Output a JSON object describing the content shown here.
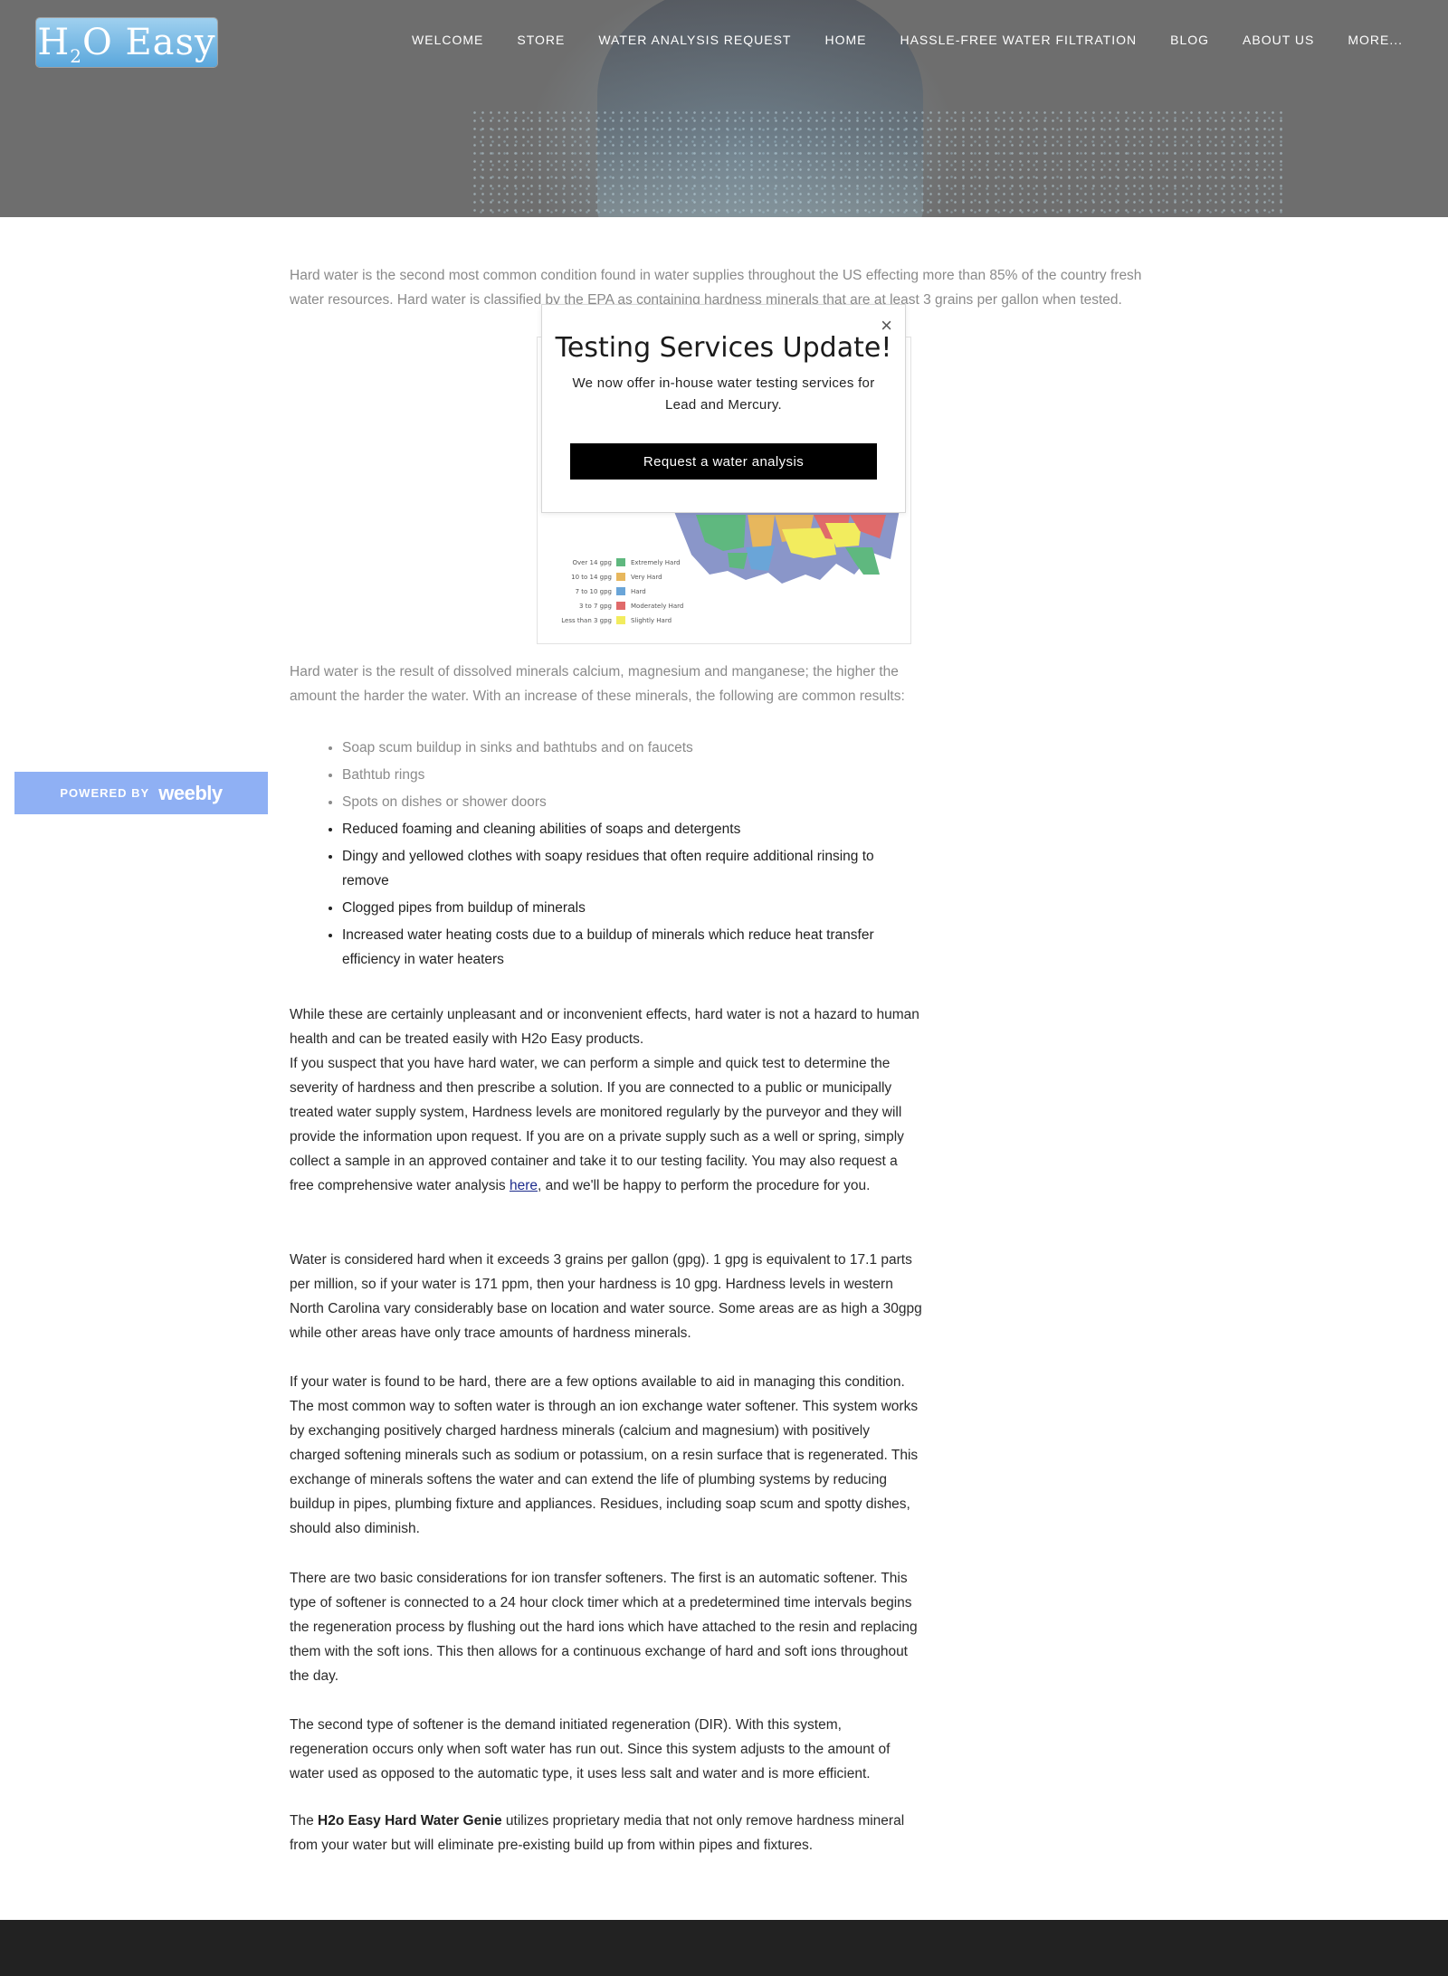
{
  "brand": {
    "logo_text": "H2O Easy"
  },
  "nav": {
    "items": [
      {
        "label": "WELCOME"
      },
      {
        "label": "STORE"
      },
      {
        "label": "WATER ANALYSIS REQUEST"
      },
      {
        "label": "HOME"
      },
      {
        "label": "HASSLE-FREE WATER FILTRATION"
      },
      {
        "label": "BLOG"
      },
      {
        "label": "ABOUT US"
      },
      {
        "label": "MORE..."
      }
    ]
  },
  "content": {
    "intro": "Hard water is the second most common condition found in water supplies throughout the US effecting more than 85% of the country fresh water resources. Hard water is classified by the EPA as containing hardness minerals that are at least 3 grains per gallon when tested.",
    "map_legend": [
      {
        "label": "Over 14 gpg",
        "name": "Extremely Hard",
        "color": "#5fb87f"
      },
      {
        "label": "10 to 14 gpg",
        "name": "Very Hard",
        "color": "#e7b75d"
      },
      {
        "label": "7 to 10 gpg",
        "name": "Hard",
        "color": "#6aa5d8"
      },
      {
        "label": "3 to 7 gpg",
        "name": "Moderately Hard",
        "color": "#e06a6a"
      },
      {
        "label": "Less than 3 gpg",
        "name": "Slightly Hard",
        "color": "#f2ec5e"
      }
    ],
    "p1": "Hard water is the result of dissolved minerals calcium, magnesium and manganese; the higher the amount the harder the water. With an increase of these minerals, the following are common results:",
    "list": [
      "Soap scum buildup in sinks and bathtubs and on faucets",
      "Bathtub rings",
      "Spots on dishes or shower doors",
      "Reduced foaming and cleaning abilities of soaps and detergents",
      "Dingy and yellowed clothes with soapy residues that often require additional rinsing to remove",
      "Clogged pipes from buildup of minerals",
      "Increased water heating costs due to a buildup of minerals which reduce heat transfer efficiency in water heaters"
    ],
    "p2": "While these are certainly unpleasant and or inconvenient effects, hard water is not a hazard to human health and can be treated easily with H2o Easy products.",
    "p3_before": "If you suspect that you have hard water, we can perform a simple and quick test to determine the severity of hardness and then prescribe a solution. If you are connected to a public or municipally treated water supply system, Hardness levels are monitored regularly by the purveyor and they will provide the information upon request. If you are on a private supply such as a well or spring, simply collect a sample in an approved container and take it to our testing facility. You may also request a free comprehensive water analysis ",
    "p3_link": "here",
    "p3_after": ", and we'll be happy to perform the procedure for you.",
    "p4": "Water is considered hard when it exceeds 3 grains per gallon (gpg). 1 gpg is equivalent to 17.1 parts per million, so if your water is 171 ppm, then your hardness is 10 gpg. Hardness levels in western North Carolina vary considerably base on location and water source. Some areas are as high a 30gpg while other areas have only trace amounts of hardness minerals.",
    "p5": "If your water is found to be hard, there are a few options available to aid in managing this condition. The most common way to soften water is through an ion exchange water softener. This system works by exchanging positively charged hardness minerals (calcium and magnesium) with positively charged softening minerals such as sodium or potassium, on a resin surface that is regenerated. This exchange of minerals softens the water and can extend the life of plumbing systems by reducing buildup in pipes, plumbing fixture and appliances. Residues, including soap scum and spotty dishes, should also diminish.",
    "p6": "There are two basic considerations for ion transfer softeners. The first is an automatic softener. This type of softener is connected to a 24 hour clock timer which at a predetermined time intervals begins the regeneration process by flushing out the hard ions which have attached to the resin and replacing them with the soft ions. This then allows for a continuous exchange of hard and soft ions throughout the day.",
    "p7": "The second type of softener is the demand initiated regeneration (DIR). With this system, regeneration occurs only when soft water has run out. Since this system adjusts to the amount of water used as opposed to the automatic type, it uses less salt and water and is more efficient.",
    "p8_before": "The ",
    "p8_bold": "H2o Easy Hard Water Genie",
    "p8_after": " utilizes proprietary media that not only remove hardness mineral from your water but will eliminate pre-existing build up from within pipes and fixtures."
  },
  "popup": {
    "close": "×",
    "title": "Testing Services Update!",
    "body": "We now offer in-house water testing services for Lead and Mercury.",
    "button": "Request a water analysis"
  },
  "badge": {
    "powered_by": "POWERED BY",
    "brand": "weebly"
  }
}
